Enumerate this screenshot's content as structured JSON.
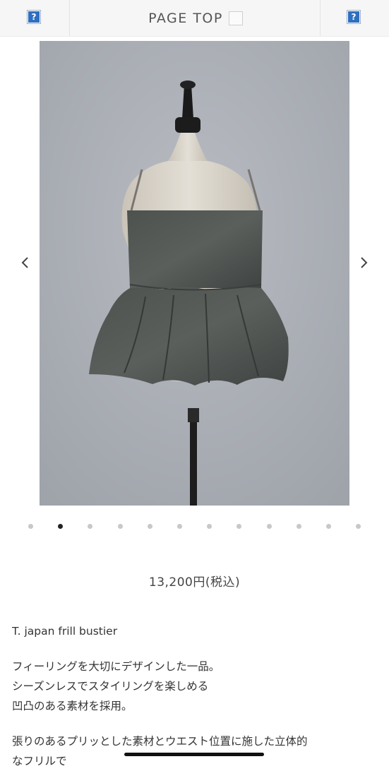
{
  "header": {
    "page_top_label": "PAGE TOP",
    "left_icon": "?",
    "right_icon": "?"
  },
  "gallery": {
    "prev_icon": "chevron-left-icon",
    "next_icon": "chevron-right-icon",
    "slide_count": 12,
    "active_index": 1
  },
  "product": {
    "price": "13,200円(税込)",
    "name": "T. japan frill bustier",
    "description": [
      "フィーリングを大切にデザインした一品。",
      "シーズンレスでスタイリングを楽しめる",
      "凹凸のある素材を採用。"
    ],
    "description2": [
      "張りのあるプリッとした素材とウエスト位置に施した立体的",
      "なフリルで"
    ]
  },
  "colors": {
    "background": "#ffffff",
    "header_bg": "#f6f6f6",
    "icon_blue": "#2f6fc0",
    "dot_active": "#222222",
    "dot_inactive": "#c8c8c8",
    "text": "#333333"
  }
}
